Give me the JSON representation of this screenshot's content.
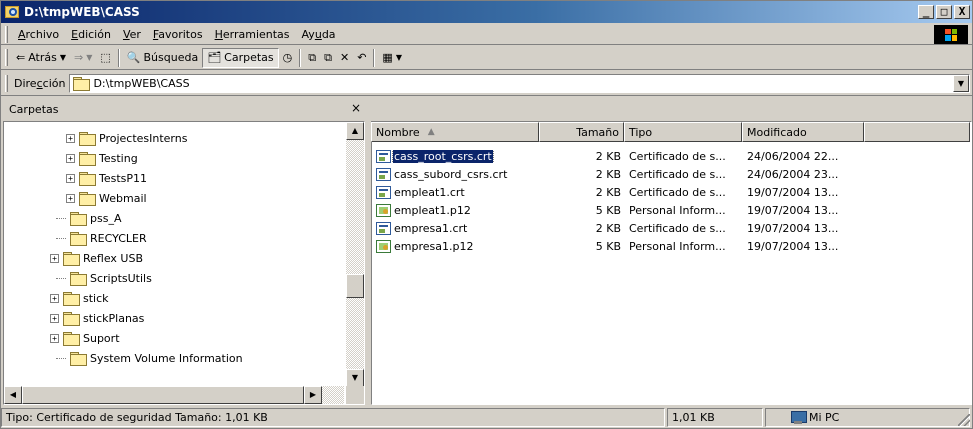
{
  "window": {
    "title": "D:\\tmpWEB\\CASS",
    "minimize_label": "_",
    "maximize_label": "□",
    "close_label": "X"
  },
  "menubar": {
    "items": [
      {
        "accel": "A",
        "rest": "rchivo"
      },
      {
        "accel": "E",
        "rest": "dición"
      },
      {
        "accel": "V",
        "rest": "er"
      },
      {
        "accel": "F",
        "rest": "avoritos"
      },
      {
        "accel": "H",
        "rest": "erramientas"
      },
      {
        "pre": "Ay",
        "accel": "u",
        "rest": "da"
      }
    ]
  },
  "toolbar": {
    "back_label": "Atrás",
    "search_label": "Búsqueda",
    "folders_label": "Carpetas"
  },
  "address": {
    "label_pre": "Dire",
    "label_accel": "c",
    "label_post": "ción",
    "value": "D:\\tmpWEB\\CASS"
  },
  "folders_pane": {
    "title": "Carpetas",
    "close": "×",
    "items": [
      {
        "label": "ProjectesInterns",
        "expander": "+"
      },
      {
        "label": "Testing",
        "expander": "+"
      },
      {
        "label": "TestsP11",
        "expander": "+"
      },
      {
        "label": "Webmail",
        "expander": "+"
      },
      {
        "label": "pss_A",
        "expander": ""
      },
      {
        "label": "RECYCLER",
        "expander": ""
      },
      {
        "label": "Reflex USB",
        "expander": "+"
      },
      {
        "label": "ScriptsUtils",
        "expander": ""
      },
      {
        "label": "stick",
        "expander": "+"
      },
      {
        "label": "stickPlanas",
        "expander": "+"
      },
      {
        "label": "Suport",
        "expander": "+"
      },
      {
        "label": "System Volume Information",
        "expander": ""
      }
    ]
  },
  "file_list": {
    "columns": {
      "name": "Nombre",
      "size": "Tamaño",
      "type": "Tipo",
      "modified": "Modificado"
    },
    "rows": [
      {
        "name": "cass_root_csrs.crt",
        "size": "2 KB",
        "type": "Certificado de s...",
        "modified": "24/06/2004 22...",
        "icon": "certificate-icon",
        "selected": true
      },
      {
        "name": "cass_subord_csrs.crt",
        "size": "2 KB",
        "type": "Certificado de s...",
        "modified": "24/06/2004 23...",
        "icon": "certificate-icon",
        "selected": false
      },
      {
        "name": "empleat1.crt",
        "size": "2 KB",
        "type": "Certificado de s...",
        "modified": "19/07/2004 13...",
        "icon": "certificate-icon",
        "selected": false
      },
      {
        "name": "empleat1.p12",
        "size": "5 KB",
        "type": "Personal Inform...",
        "modified": "19/07/2004 13...",
        "icon": "personal-info-exchange-icon",
        "selected": false
      },
      {
        "name": "empresa1.crt",
        "size": "2 KB",
        "type": "Certificado de s...",
        "modified": "19/07/2004 13...",
        "icon": "certificate-icon",
        "selected": false
      },
      {
        "name": "empresa1.p12",
        "size": "5 KB",
        "type": "Personal Inform...",
        "modified": "19/07/2004 13...",
        "icon": "personal-info-exchange-icon",
        "selected": false
      }
    ]
  },
  "statusbar": {
    "info": "Tipo: Certificado de seguridad Tamaño: 1,01 KB",
    "size": "1,01 KB",
    "zone": "Mi PC"
  },
  "colors": {
    "title_gradient_start": "#0a246a",
    "title_gradient_end": "#a6caf0",
    "selection": "#0a246a",
    "chrome": "#d4d0c8"
  }
}
